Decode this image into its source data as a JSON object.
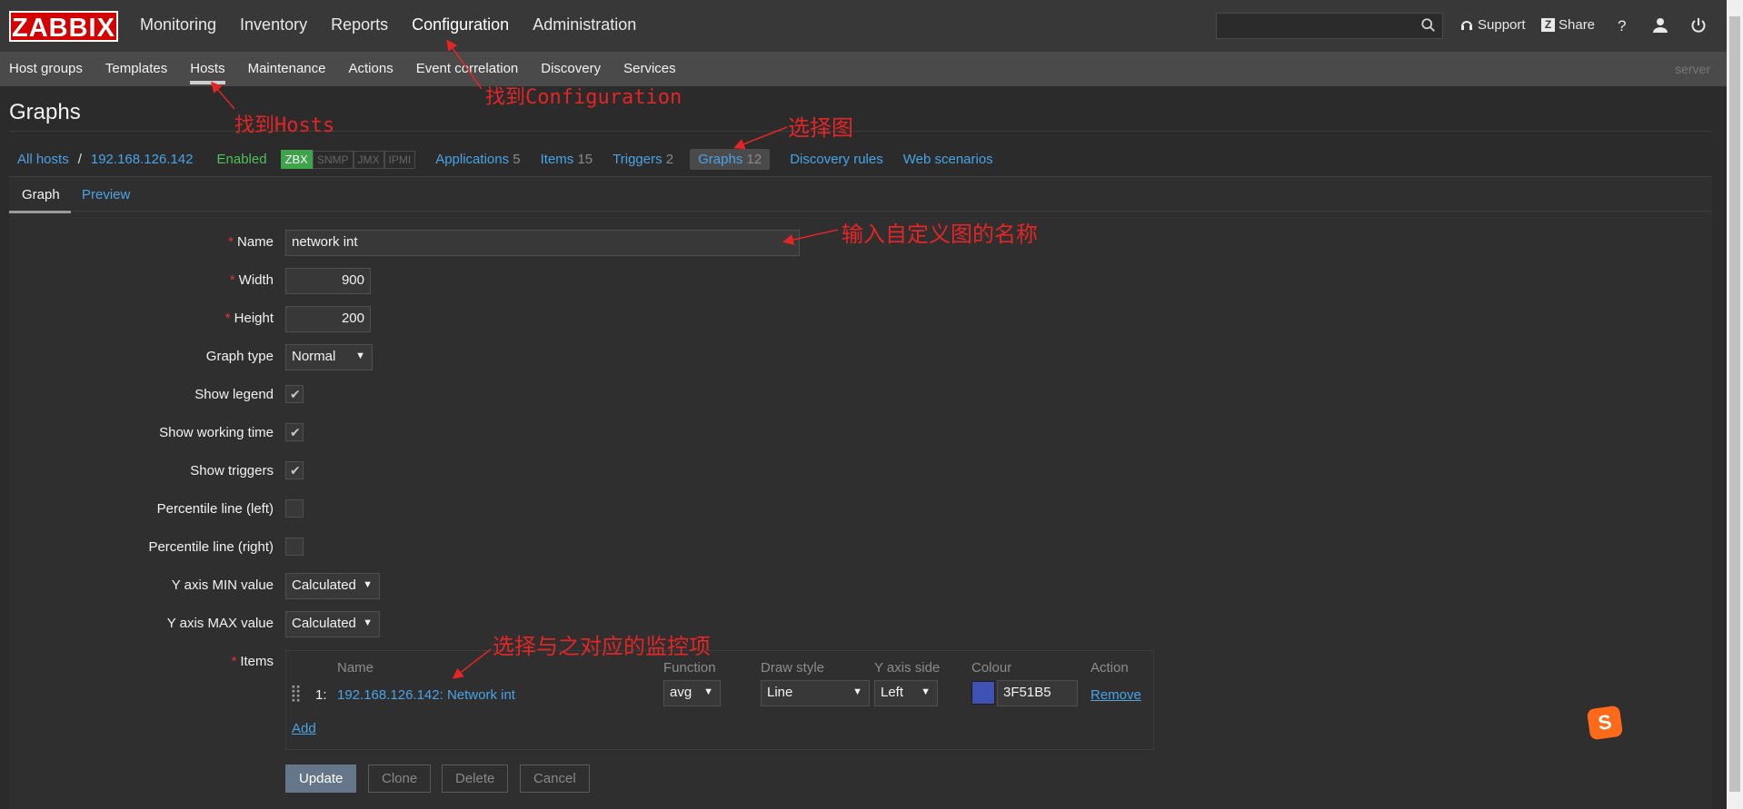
{
  "header": {
    "logo": "ZABBIX",
    "nav": [
      "Monitoring",
      "Inventory",
      "Reports",
      "Configuration",
      "Administration"
    ],
    "support": "Support",
    "share": "Share",
    "help": "?"
  },
  "subnav": {
    "items": [
      "Host groups",
      "Templates",
      "Hosts",
      "Maintenance",
      "Actions",
      "Event correlation",
      "Discovery",
      "Services"
    ],
    "server": "server"
  },
  "page": {
    "title": "Graphs"
  },
  "breadcrumbs": {
    "all_hosts": "All hosts",
    "separator": "/",
    "host": "192.168.126.142",
    "status": "Enabled",
    "tags": [
      "ZBX",
      "SNMP",
      "JMX",
      "IPMI"
    ],
    "applications": {
      "label": "Applications",
      "count": "5"
    },
    "items": {
      "label": "Items",
      "count": "15"
    },
    "triggers": {
      "label": "Triggers",
      "count": "2"
    },
    "graphs": {
      "label": "Graphs",
      "count": "12"
    },
    "discovery": "Discovery rules",
    "web": "Web scenarios"
  },
  "tabs": [
    "Graph",
    "Preview"
  ],
  "form": {
    "required_mark": "*",
    "name_label": "Name",
    "name_value": "network int",
    "width_label": "Width",
    "width_value": "900",
    "height_label": "Height",
    "height_value": "200",
    "graph_type_label": "Graph type",
    "graph_type_value": "Normal",
    "show_legend_label": "Show legend",
    "show_working_time_label": "Show working time",
    "show_triggers_label": "Show triggers",
    "percentile_left_label": "Percentile line (left)",
    "percentile_right_label": "Percentile line (right)",
    "ymin_label": "Y axis MIN value",
    "ymin_value": "Calculated",
    "ymax_label": "Y axis MAX value",
    "ymax_value": "Calculated",
    "items_label": "Items"
  },
  "items_table": {
    "headers": [
      "Name",
      "Function",
      "Draw style",
      "Y axis side",
      "Colour",
      "Action"
    ],
    "rows": [
      {
        "index": "1:",
        "name": "192.168.126.142: Network int",
        "function": "avg",
        "draw_style": "Line",
        "y_axis_side": "Left",
        "colour": "3F51B5",
        "action": "Remove"
      }
    ],
    "add": "Add"
  },
  "buttons": {
    "update": "Update",
    "clone": "Clone",
    "delete": "Delete",
    "cancel": "Cancel"
  },
  "annotations": {
    "find_hosts": "找到Hosts",
    "find_configuration": "找到Configuration",
    "select_graph": "选择图",
    "enter_name": "输入自定义图的名称",
    "select_item": "选择与之对应的监控项"
  },
  "colors": {
    "swatch": "#3F51B5",
    "logo": "#d40000",
    "link": "#4aa3e5",
    "enabled": "#4fc05b"
  }
}
